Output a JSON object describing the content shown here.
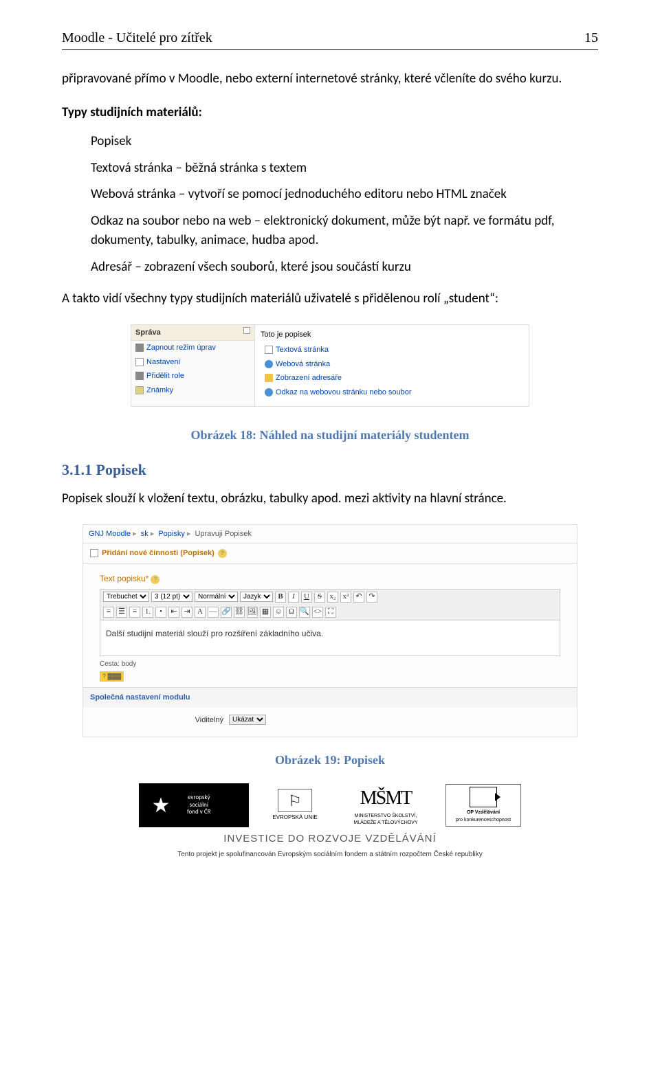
{
  "header": {
    "title": "Moodle - Učitelé pro zítřek",
    "page_number": "15"
  },
  "intro": "připravované přímo v Moodle, nebo externí internetové stránky, které včleníte do svého kurzu.",
  "h2": "Typy studijních materiálů:",
  "types": {
    "popisek": "Popisek",
    "textova": "Textová stránka – běžná stránka s textem",
    "webova": "Webová stránka – vytvoří se pomocí jednoduchého editoru nebo HTML značek",
    "odkaz": "Odkaz na soubor nebo na web – elektronický dokument, může být např. ve formátu pdf, dokumenty, tabulky, animace, hudba apod.",
    "adresar": "Adresář – zobrazení všech souborů, které jsou součástí kurzu"
  },
  "para_student": "A takto vidí všechny typy studijních materiálů uživatelé s přidělenou rolí „student“:",
  "mock1": {
    "panel_title": "Správa",
    "left_items": [
      "Zapnout režim úprav",
      "Nastavení",
      "Přidělit role",
      "Známky"
    ],
    "label_title": "Toto je popisek",
    "right_items": [
      "Textová stránka",
      "Webová stránka",
      "Zobrazení adresáře",
      "Odkaz na webovou stránku nebo soubor"
    ]
  },
  "caption1": "Obrázek 18: Náhled na studijní materiály studentem",
  "h311": "3.1.1  Popisek",
  "para_popisek": "Popisek slouží k vložení textu, obrázku, tabulky apod. mezi aktivity na hlavní stránce.",
  "mock2": {
    "crumb": [
      "GNJ Moodle",
      "sk",
      "Popisky",
      "Upravuji Popisek"
    ],
    "sec_head": "Přidání nové činnosti (Popisek)",
    "label": "Text popisku*",
    "toolbar": {
      "font": "Trebuchet",
      "size_opts": "3 (12 pt)",
      "style": "Normální",
      "lang": "Jazyk",
      "buttons": [
        "B",
        "I",
        "U",
        "S"
      ]
    },
    "editor_text": "Další studijní materiál slouží pro rozšíření základního učiva.",
    "path_label": "Cesta:",
    "path_value": "body",
    "mod_head": "Společná nastavení modulu",
    "visible_label": "Viditelný",
    "visible_value": "Ukázat"
  },
  "caption2": "Obrázek 19: Popisek",
  "footer": {
    "esf": {
      "l1": "evropský",
      "l2": "sociální",
      "l3": "fond v ČR"
    },
    "eu": "EVROPSKÁ UNIE",
    "msmt": {
      "logo": "MŠMT",
      "l1": "MINISTERSTVO ŠKOLSTVÍ,",
      "l2": "MLÁDEŽE A TĚLOVÝCHOVY"
    },
    "opvk": {
      "l1": "OP Vzdělávání",
      "l2": "pro konkurenceschopnost"
    },
    "invest": "INVESTICE DO ROZVOJE VZDĚLÁVÁNÍ",
    "cofund": "Tento projekt je spolufinancován Evropským sociálním fondem a státním rozpočtem České republiky"
  }
}
